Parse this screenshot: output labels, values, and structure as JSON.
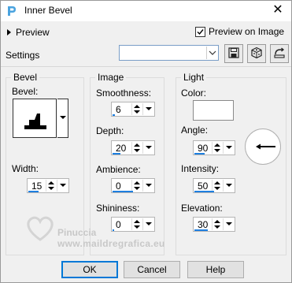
{
  "window": {
    "title": "Inner Bevel",
    "close_glyph": "✕",
    "icon": "app-icon"
  },
  "preview": {
    "toggle_label": "Preview",
    "preview_on_image_label": "Preview on Image",
    "preview_on_image_checked": true
  },
  "settings": {
    "label": "Settings",
    "selected_value": ""
  },
  "bevel_group": {
    "title": "Bevel",
    "bevel_label": "Bevel:",
    "width_label": "Width:",
    "width_value": "15",
    "width_fraction": 0.25
  },
  "image_group": {
    "title": "Image",
    "smoothness_label": "Smoothness:",
    "smoothness_value": "6",
    "smoothness_fraction": 0.06,
    "depth_label": "Depth:",
    "depth_value": "20",
    "depth_fraction": 0.2,
    "ambience_label": "Ambience:",
    "ambience_value": "0",
    "ambience_fraction": 0.5,
    "shininess_label": "Shininess:",
    "shininess_value": "0",
    "shininess_fraction": 0.0
  },
  "light_group": {
    "title": "Light",
    "color_label": "Color:",
    "color_value": "#ffffff",
    "angle_label": "Angle:",
    "angle_value": "90",
    "angle_fraction": 0.25,
    "intensity_label": "Intensity:",
    "intensity_value": "50",
    "intensity_fraction": 0.5,
    "elevation_label": "Elevation:",
    "elevation_value": "30",
    "elevation_fraction": 0.33
  },
  "watermark": {
    "line1": "Pinuccia",
    "line2": "www.maildregrafica.eu"
  },
  "buttons": {
    "ok": "OK",
    "cancel": "Cancel",
    "help": "Help"
  },
  "colors": {
    "accent": "#1e7fe0",
    "default_border": "#0078d7"
  }
}
